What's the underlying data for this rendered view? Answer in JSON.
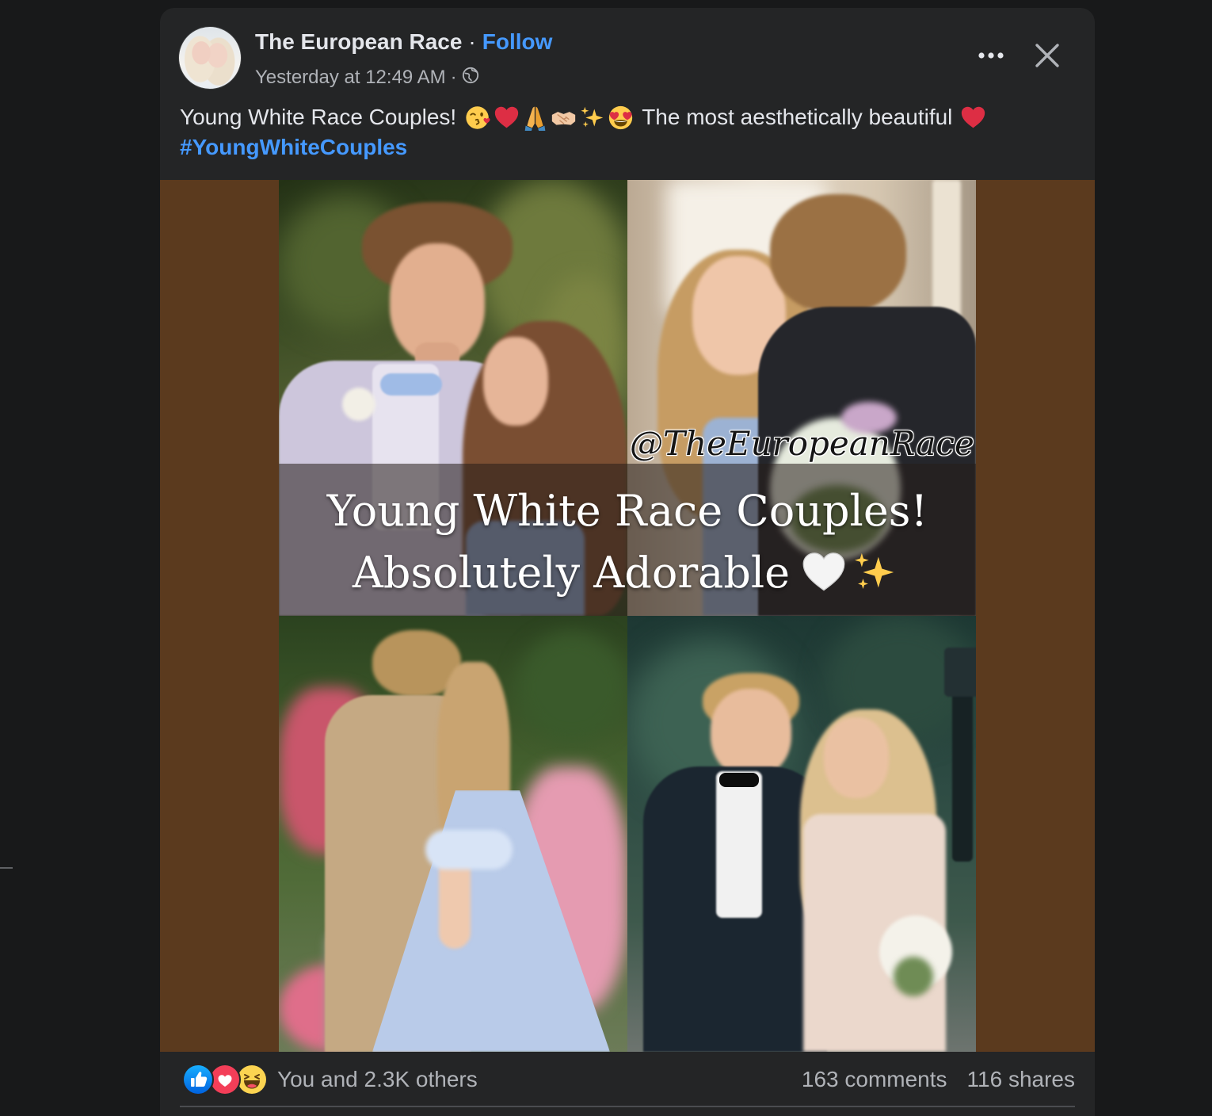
{
  "post": {
    "author": {
      "name": "The European Race",
      "separator": "·",
      "follow_label": "Follow",
      "timestamp": "Yesterday at 12:49 AM",
      "timestamp_separator": "·",
      "audience_icon": "globe-icon"
    },
    "header": {
      "more_icon": "more-options-icon",
      "close_icon": "close-icon"
    },
    "text": {
      "title": "Young White Race Couples!",
      "title_emojis": [
        "kissing-face-emoji",
        "red-heart-emoji",
        "folded-hands-emoji",
        "handshake-emoji",
        "sparkles-emoji",
        "heart-eyes-emoji"
      ],
      "continuation": "The most aesthetically beautiful",
      "end_emoji": "red-heart-emoji",
      "hashtag": "#YoungWhiteCouples"
    },
    "image": {
      "watermark": "@TheEuropeanRace",
      "caption_line1": "Young White Race Couples!",
      "caption_line2": "Absolutely Adorable",
      "caption_line2_emojis": [
        "white-heart-emoji",
        "sparkles-emoji"
      ]
    },
    "footer": {
      "reaction_icons": [
        "like-icon",
        "love-icon",
        "haha-icon"
      ],
      "reactions_summary": "You and 2.3K others",
      "comments": "163 comments",
      "shares": "116 shares"
    }
  },
  "colors": {
    "page_background": "#18191a",
    "card_background": "#242526",
    "primary_text": "#e4e6eb",
    "secondary_text": "#b0b3b8",
    "link_blue": "#4599ff",
    "image_frame": "#5b3a1e",
    "divider": "#4a4c50"
  }
}
